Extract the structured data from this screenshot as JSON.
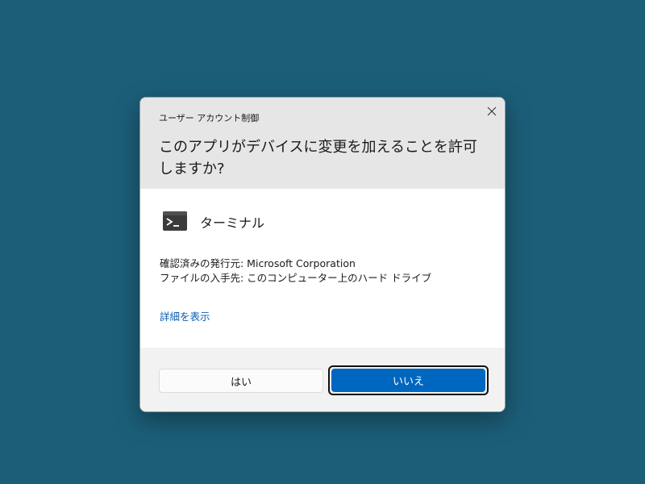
{
  "dialog": {
    "window_title": "ユーザー アカウント制御",
    "question": "このアプリがデバイスに変更を加えることを許可しますか?",
    "app": {
      "name": "ターミナル",
      "icon": "terminal-icon"
    },
    "publisher_line": "確認済みの発行元: Microsoft Corporation",
    "origin_line": "ファイルの入手先: このコンピューター上のハード ドライブ",
    "details_link": "詳細を表示",
    "buttons": {
      "yes_label": "はい",
      "no_label": "いいえ"
    }
  },
  "colors": {
    "desktop_background": "#1c5e78",
    "header_background": "#e6e6e6",
    "footer_background": "#f2f2f2",
    "accent": "#0067c0",
    "link": "#0a5cad"
  }
}
